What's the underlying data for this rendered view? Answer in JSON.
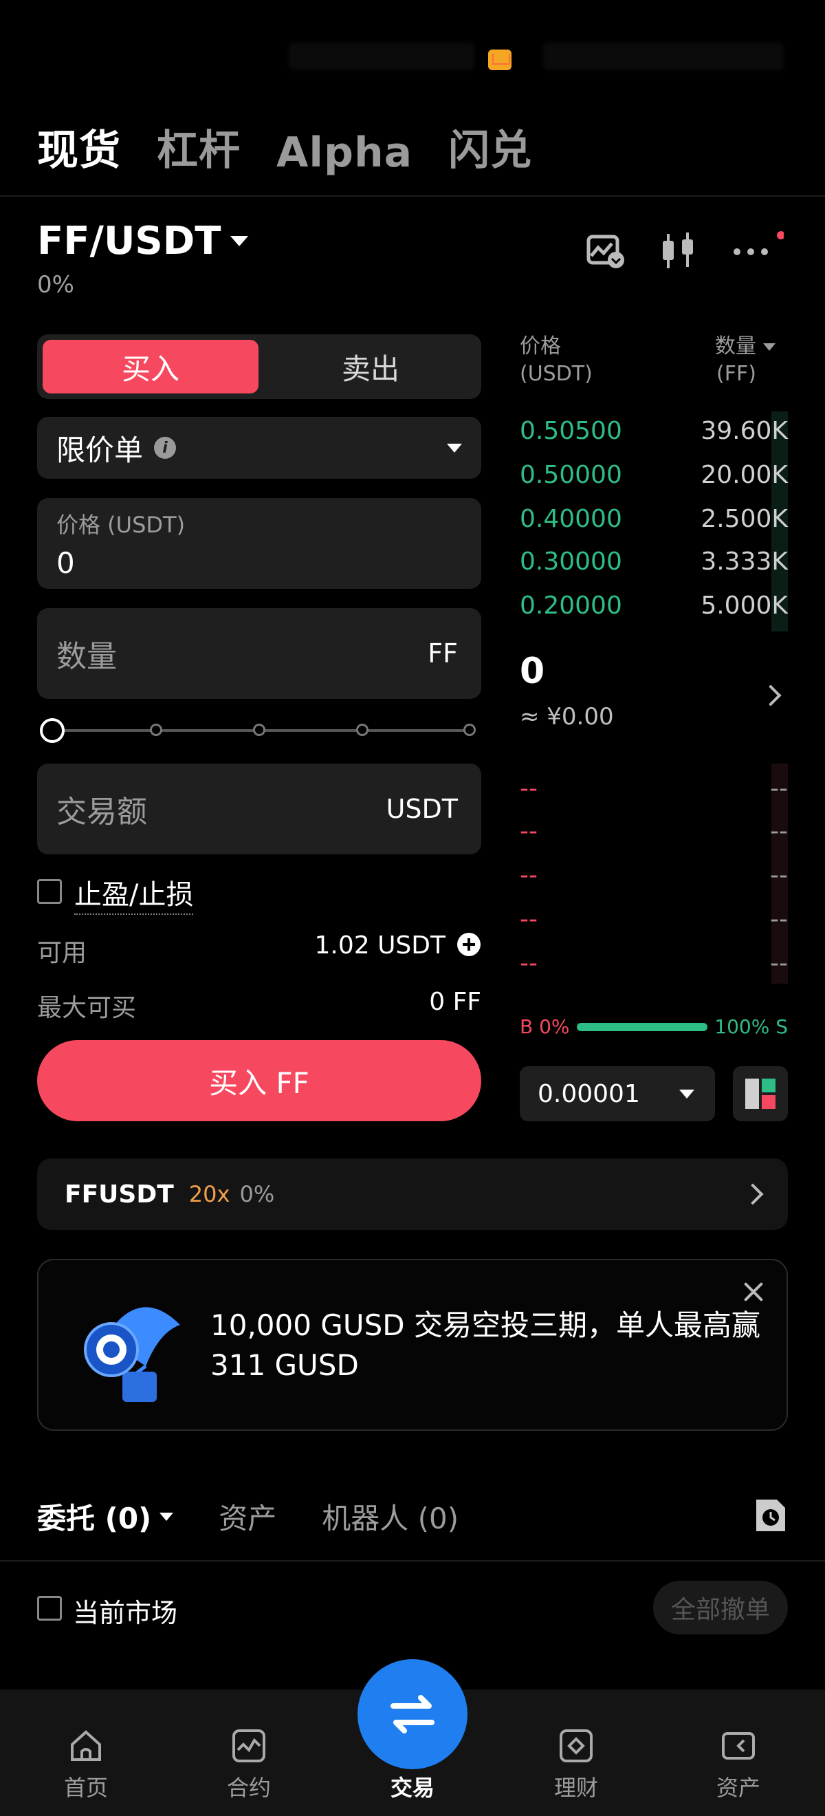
{
  "top_tabs": [
    "现货",
    "杠杆",
    "Alpha",
    "闪兑"
  ],
  "pair": {
    "symbol": "FF/USDT",
    "change": "0%"
  },
  "side": {
    "buy": "买入",
    "sell": "卖出"
  },
  "order_type": {
    "label": "限价单",
    "info": "i"
  },
  "price_field": {
    "label": "价格 (USDT)",
    "value": "0"
  },
  "quantity_field": {
    "placeholder": "数量",
    "unit": "FF"
  },
  "amount_field": {
    "placeholder": "交易额",
    "unit": "USDT"
  },
  "tp_sl": {
    "label": "止盈/止损"
  },
  "available": {
    "label": "可用",
    "value": "1.02 USDT"
  },
  "max_buy": {
    "label": "最大可买",
    "value": "0 FF"
  },
  "buy_button": "买入 FF",
  "orderbook": {
    "header": {
      "price_line1": "价格",
      "price_line2": "(USDT)",
      "qty_line1": "数量",
      "qty_line2": "(FF)"
    },
    "bids": [
      {
        "price": "0.50500",
        "qty": "39.60K"
      },
      {
        "price": "0.50000",
        "qty": "20.00K"
      },
      {
        "price": "0.40000",
        "qty": "2.500K"
      },
      {
        "price": "0.30000",
        "qty": "3.333K"
      },
      {
        "price": "0.20000",
        "qty": "5.000K"
      }
    ],
    "last_price": "0",
    "last_price_cny": "≈ ¥0.00",
    "asks": [
      {
        "price": "--",
        "qty": "--"
      },
      {
        "price": "--",
        "qty": "--"
      },
      {
        "price": "--",
        "qty": "--"
      },
      {
        "price": "--",
        "qty": "--"
      },
      {
        "price": "--",
        "qty": "--"
      }
    ],
    "ratio": {
      "buy": "B 0%",
      "sell": "100% S",
      "buy_fraction": 0.0
    },
    "precision": "0.00001"
  },
  "futures_card": {
    "symbol": "FFUSDT",
    "leverage": "20x",
    "change": "0%"
  },
  "promo": {
    "text": "10,000 GUSD 交易空投三期，单人最高赢 311 GUSD"
  },
  "order_tabs": [
    "委托 (0)",
    "资产",
    "机器人 (0)"
  ],
  "current_market": "当前市场",
  "cancel_all": "全部撤单",
  "nav": [
    "首页",
    "合约",
    "交易",
    "理财",
    "资产"
  ],
  "colors": {
    "buy": "#f6485e",
    "bid": "#2ebd85",
    "accent": "#1f7ff0",
    "leverage": "#f0a04b"
  }
}
